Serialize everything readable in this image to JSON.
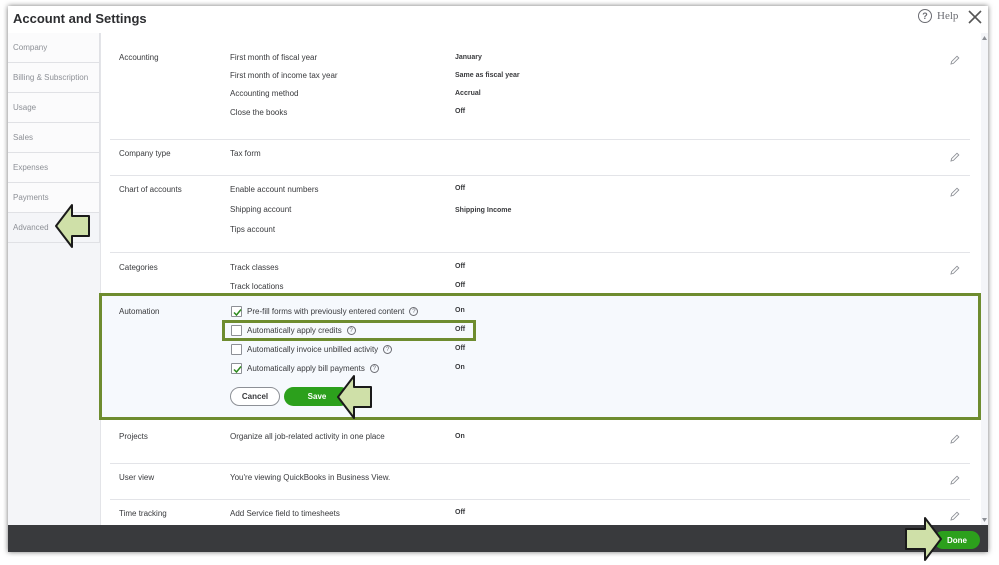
{
  "dialog": {
    "title": "Account and Settings",
    "help_label": "Help",
    "done_label": "Done"
  },
  "sidebar": {
    "items": [
      {
        "label": "Company"
      },
      {
        "label": "Billing & Subscription"
      },
      {
        "label": "Usage"
      },
      {
        "label": "Sales"
      },
      {
        "label": "Expenses"
      },
      {
        "label": "Payments"
      },
      {
        "label": "Advanced"
      }
    ],
    "active": "Advanced"
  },
  "sections": {
    "accounting": {
      "label": "Accounting",
      "rows": [
        {
          "label": "First month of fiscal year",
          "value": "January"
        },
        {
          "label": "First month of income tax year",
          "value": "Same as fiscal year"
        },
        {
          "label": "Accounting method",
          "value": "Accrual"
        },
        {
          "label": "Close the books",
          "value": "Off"
        }
      ]
    },
    "company_type": {
      "label": "Company type",
      "rows": [
        {
          "label": "Tax form",
          "value": ""
        }
      ]
    },
    "chart_of_accounts": {
      "label": "Chart of accounts",
      "rows": [
        {
          "label": "Enable account numbers",
          "value": "Off"
        },
        {
          "label": "Shipping account",
          "value": "Shipping Income"
        },
        {
          "label": "Tips account",
          "value": ""
        }
      ]
    },
    "categories": {
      "label": "Categories",
      "rows": [
        {
          "label": "Track classes",
          "value": "Off"
        },
        {
          "label": "Track locations",
          "value": "Off"
        }
      ]
    },
    "automation": {
      "label": "Automation",
      "options": [
        {
          "label": "Pre-fill forms with previously entered content",
          "checked": true,
          "value": "On"
        },
        {
          "label": "Automatically apply credits",
          "checked": false,
          "value": "Off"
        },
        {
          "label": "Automatically invoice unbilled activity",
          "checked": false,
          "value": "Off"
        },
        {
          "label": "Automatically apply bill payments",
          "checked": true,
          "value": "On"
        }
      ],
      "cancel_label": "Cancel",
      "save_label": "Save"
    },
    "projects": {
      "label": "Projects",
      "rows": [
        {
          "label": "Organize all job-related activity in one place",
          "value": "On"
        }
      ]
    },
    "user_view": {
      "label": "User view",
      "rows": [
        {
          "label": "You're viewing QuickBooks in Business View.",
          "value": ""
        }
      ]
    },
    "time_tracking": {
      "label": "Time tracking",
      "rows": [
        {
          "label": "Add Service field to timesheets",
          "value": "Off"
        }
      ]
    }
  },
  "colors": {
    "accent_green": "#2ca01c",
    "callout_fill": "#cfe0a8",
    "highlight_border": "#6e8c2f",
    "footer_bg": "#393a3d"
  },
  "icons": {
    "help": "help-circle-icon",
    "close": "close-icon",
    "edit": "pencil-icon",
    "callout": "arrow-callout-icon"
  }
}
